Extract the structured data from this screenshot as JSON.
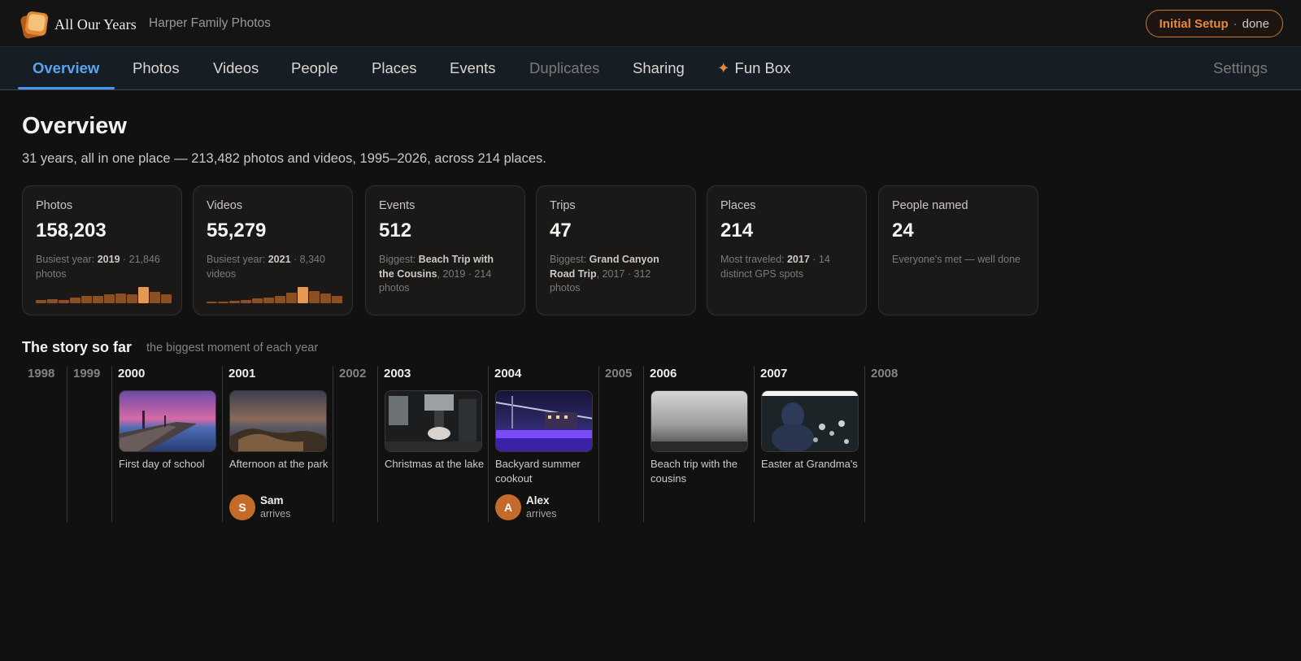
{
  "app": {
    "name": "All Our Years",
    "family": "Harper Family Photos",
    "setup": {
      "label": "Initial Setup",
      "separator": "·",
      "status": "done"
    }
  },
  "nav": {
    "items": [
      "Overview",
      "Photos",
      "Videos",
      "People",
      "Places",
      "Events",
      "Duplicates",
      "Sharing",
      "Fun Box"
    ],
    "settings": "Settings",
    "active": "Overview",
    "accent": "#4a96e8"
  },
  "overview": {
    "title": "Overview",
    "subtitle": "31 years, all in one place — 213,482 photos and videos, 1995–2026, across 214 places."
  },
  "cards": [
    {
      "label": "Photos",
      "value": "158,203",
      "note_pre": "Busiest year: ",
      "note_bold": "2019",
      "note_post": " · 21,846 photos",
      "bars": [
        0.18,
        0.25,
        0.22,
        0.35,
        0.45,
        0.45,
        0.55,
        0.6,
        0.55,
        1.0,
        0.7,
        0.55
      ]
    },
    {
      "label": "Videos",
      "value": "55,279",
      "note_pre": "Busiest year: ",
      "note_bold": "2021",
      "note_post": " · 8,340 videos",
      "bars": [
        0.05,
        0.1,
        0.15,
        0.2,
        0.3,
        0.35,
        0.45,
        0.65,
        1.0,
        0.75,
        0.6,
        0.45
      ]
    },
    {
      "label": "Events",
      "value": "512",
      "note_pre": "Biggest: ",
      "note_bold": "Beach Trip with the Cousins",
      "note_post": ", 2019 · 214 photos"
    },
    {
      "label": "Trips",
      "value": "47",
      "note_pre": "Biggest: ",
      "note_bold": "Grand Canyon Road Trip",
      "note_post": ", 2017 · 312 photos"
    },
    {
      "label": "Places",
      "value": "214",
      "note_pre": "Most traveled: ",
      "note_bold": "2017",
      "note_post": " · 14 distinct GPS spots"
    },
    {
      "label": "People named",
      "value": "24",
      "note_pre": "Everyone's met — well done",
      "note_bold": "",
      "note_post": ""
    }
  ],
  "story": {
    "title": "The story so far",
    "subtitle": "the biggest moment of each year",
    "years": [
      {
        "year": "1998",
        "active": false
      },
      {
        "year": "1999",
        "active": false
      },
      {
        "year": "2000",
        "active": true,
        "caption": "First day of school",
        "image": "dock-sunset"
      },
      {
        "year": "2001",
        "active": true,
        "caption": "Afternoon at the park",
        "image": "rocky-shore-dusk",
        "arrival": {
          "initial": "S",
          "name": "Sam",
          "verb": "arrives"
        }
      },
      {
        "year": "2002",
        "active": false
      },
      {
        "year": "2003",
        "active": true,
        "caption": "Christmas at the lake",
        "image": "coffee-machine"
      },
      {
        "year": "2004",
        "active": true,
        "caption": "Backyard summer cookout",
        "image": "bridge-night",
        "arrival": {
          "initial": "A",
          "name": "Alex",
          "verb": "arrives"
        }
      },
      {
        "year": "2005",
        "active": false
      },
      {
        "year": "2006",
        "active": true,
        "caption": "Beach trip with the cousins",
        "image": "foggy-field"
      },
      {
        "year": "2007",
        "active": true,
        "caption": "Easter at Grandma's",
        "image": "hooded-figure-flowers"
      },
      {
        "year": "2008",
        "active": false
      }
    ]
  }
}
